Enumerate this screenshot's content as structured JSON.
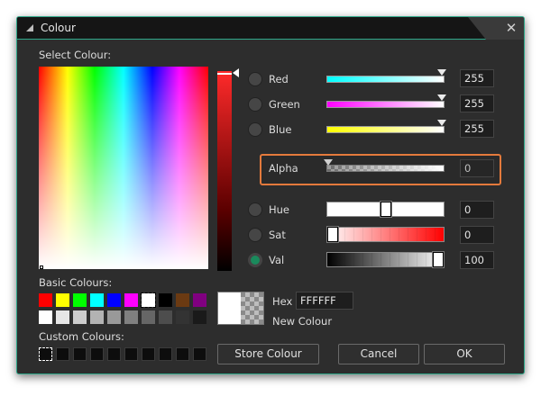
{
  "window": {
    "title": "Colour",
    "close_glyph": "✕"
  },
  "labels": {
    "select_colour": "Select Colour:",
    "basic_colours": "Basic Colours:",
    "custom_colours": "Custom Colours:",
    "hex": "Hex",
    "new_colour": "New Colour"
  },
  "channels": {
    "red": {
      "label": "Red",
      "value": "255",
      "level": 1.0
    },
    "green": {
      "label": "Green",
      "value": "255",
      "level": 1.0
    },
    "blue": {
      "label": "Blue",
      "value": "255",
      "level": 1.0
    },
    "alpha": {
      "label": "Alpha",
      "value": "0",
      "level": 0.0
    },
    "hue": {
      "label": "Hue",
      "value": "0",
      "level": 0.5
    },
    "sat": {
      "label": "Sat",
      "value": "0",
      "level": 0.0
    },
    "val": {
      "label": "Val",
      "value": "100",
      "level": 1.0
    }
  },
  "selected_mode": "Val",
  "hex_value": "FFFFFF",
  "buttons": {
    "store": "Store Colour",
    "cancel": "Cancel",
    "ok": "OK"
  },
  "basic_colours_row1": [
    "#ff0000",
    "#ffff00",
    "#00ff00",
    "#00ffff",
    "#0000ff",
    "#ff00ff",
    "#ffffff",
    "#000000",
    "#6b3a12",
    "#800080"
  ],
  "basic_colours_row2": [
    "#ffffff",
    "#e6e6e6",
    "#cccccc",
    "#b3b3b3",
    "#999999",
    "#808080",
    "#666666",
    "#4d4d4d",
    "#333333",
    "#1a1a1a"
  ],
  "colors": {
    "accent": "#2fa88a",
    "highlight": "#e47a3c",
    "background": "#2d2d2d"
  }
}
